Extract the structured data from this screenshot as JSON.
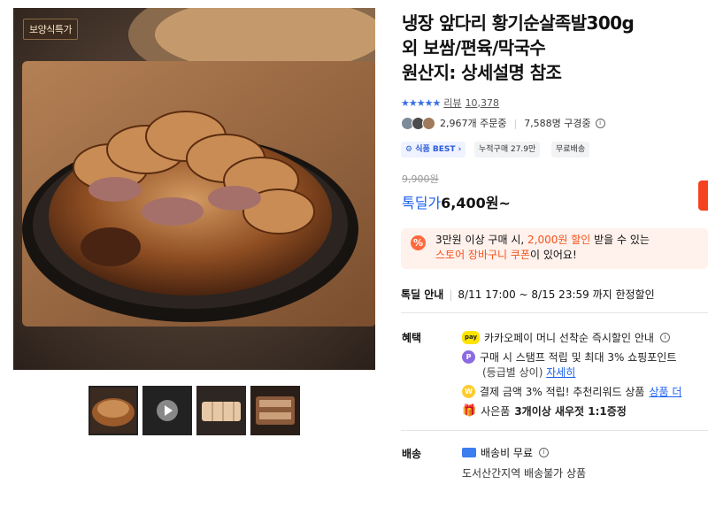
{
  "product": {
    "badge": "보양식특가",
    "title_lines": [
      "냉장 앞다리 황기순살족발300g",
      "외 보쌈/편육/막국수",
      "원산지: 상세설명 참조"
    ],
    "stars": "★★★★★",
    "review_label": "리뷰",
    "review_count": "10,378",
    "buyers": "2,967개 주문중",
    "subscribers": "7,588명 구경중"
  },
  "tags": {
    "best": "식품 BEST",
    "cumulative": "누적구매 27.9만",
    "free_ship": "무료배송"
  },
  "price": {
    "original": "9,900원",
    "deal_label": "톡딜가",
    "deal_price": "6,400원~"
  },
  "coupon": {
    "icon": "%",
    "line1_a": "3만원 이상 구매 시,",
    "line1_b": "2,000원 할인",
    "line1_c": "받을 수 있는",
    "line2_a": "스토어 장바구니 쿠폰",
    "line2_b": "이 있어요!"
  },
  "deal_info": {
    "label": "톡딜 안내",
    "period": "8/11 17:00 ~ 8/15 23:59 까지 한정할인"
  },
  "benefits": {
    "label": "혜택",
    "pay_icon": "pay",
    "item1": "카카오페이 머니 선착순 즉시할인 안내",
    "point_icon": "P",
    "item2": "구매 시 스탬프 적립 및 최대 3% 쇼핑포인트",
    "item2_sub": "(등급별 상이)",
    "item2_link": "자세히",
    "won_icon": "W",
    "item3": "결제 금액 3% 적립! 추천리워드 상품",
    "item3_link": "상품 더",
    "item4_a": "사은품",
    "item4_b": "3개이상 새우젓 1:1증정"
  },
  "shipping": {
    "label": "배송",
    "fee": "배송비 무료",
    "note": "도서산간지역 배송불가 상품"
  },
  "colors": {
    "accent_blue": "#1a5ff0",
    "accent_orange": "#f4531c"
  }
}
